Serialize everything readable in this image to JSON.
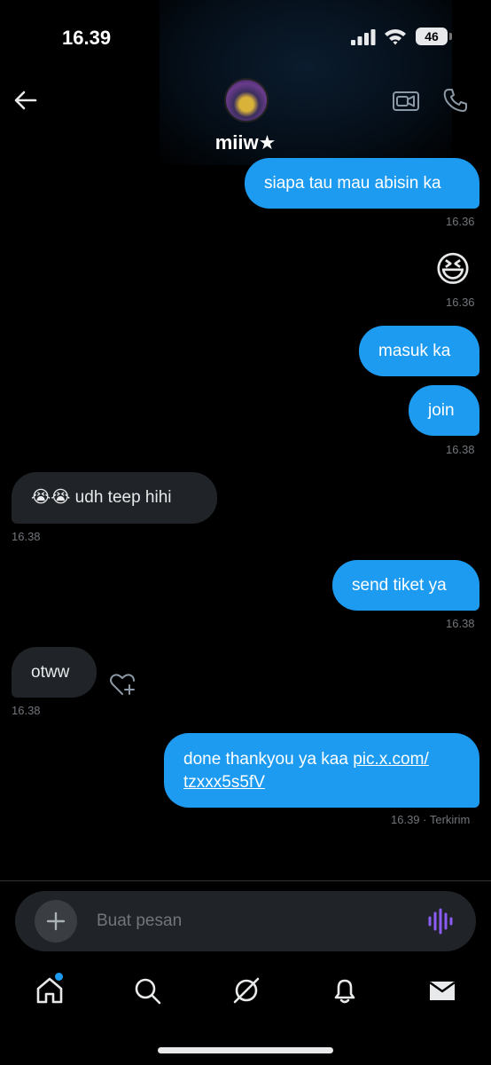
{
  "status_bar": {
    "time": "16.39",
    "battery": "46"
  },
  "header": {
    "contact_name": "miiw★"
  },
  "messages": [
    {
      "direction": "out",
      "text": "siapa tau mau abisin ka",
      "time": "16.36"
    },
    {
      "direction": "out",
      "emoji": "😆",
      "time": "16.36"
    },
    {
      "direction": "out",
      "text": "masuk ka"
    },
    {
      "direction": "out",
      "text": "join",
      "time": "16.38"
    },
    {
      "direction": "in",
      "text": "😭😭 udh teep hihi",
      "time": "16.38"
    },
    {
      "direction": "out",
      "text": "send tiket ya",
      "time": "16.38"
    },
    {
      "direction": "in",
      "text": "otww",
      "time": "16.38"
    },
    {
      "direction": "out",
      "text": "done thankyou ya kaa ",
      "link_line1": "pic.x.com/",
      "link_line2": "tzxxx5s5fV",
      "time": "16.39 · Terkirim"
    }
  ],
  "composer": {
    "placeholder": "Buat pesan"
  },
  "colors": {
    "accent": "#1d9bf0",
    "incoming_bubble": "#202327",
    "voice_icon": "#8b5cf6"
  },
  "icons": {
    "header": [
      "back-arrow-icon",
      "video-call-icon",
      "phone-icon"
    ],
    "composer": [
      "plus-icon",
      "voice-wave-icon"
    ],
    "nav": [
      "home-icon",
      "search-icon",
      "grok-icon",
      "bell-icon",
      "mail-icon"
    ],
    "reaction": "heart-plus-icon"
  },
  "nav": {
    "home_has_notification": true
  }
}
